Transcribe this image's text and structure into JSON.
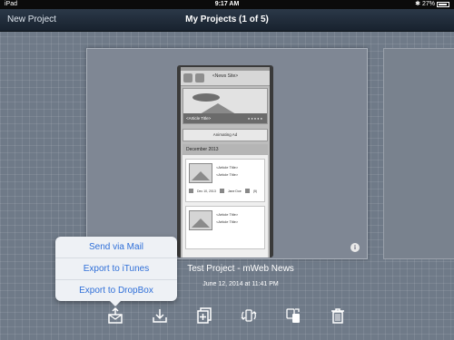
{
  "status_bar": {
    "carrier": "iPad",
    "time": "9:17 AM",
    "battery": "27%"
  },
  "nav": {
    "left_button": "New Project",
    "title": "My Projects (1 of 5)"
  },
  "mockup": {
    "header": "<News Site>",
    "banner_caption": "<Article Title>",
    "ad_label": "Animating Ad",
    "section_header": "December 2013",
    "articles": [
      {
        "line1": "<Article Title>",
        "line2": "<Article Title>",
        "date": "Dec 10, 2013",
        "author": "Jane Doe",
        "count": "(5)"
      },
      {
        "line1": "<Article Title>",
        "line2": "<Article Title>"
      }
    ]
  },
  "popover": {
    "items": [
      "Send via Mail",
      "Export to iTunes",
      "Export to DropBox"
    ]
  },
  "project": {
    "title": "Test Project - mWeb News",
    "date": "June 12, 2014 at 11:41 PM"
  },
  "toolbar": {
    "icons": [
      "share-icon",
      "download-icon",
      "duplicate-icon",
      "sync-icon",
      "preview-icon",
      "trash-icon"
    ]
  },
  "info_icon": "i"
}
